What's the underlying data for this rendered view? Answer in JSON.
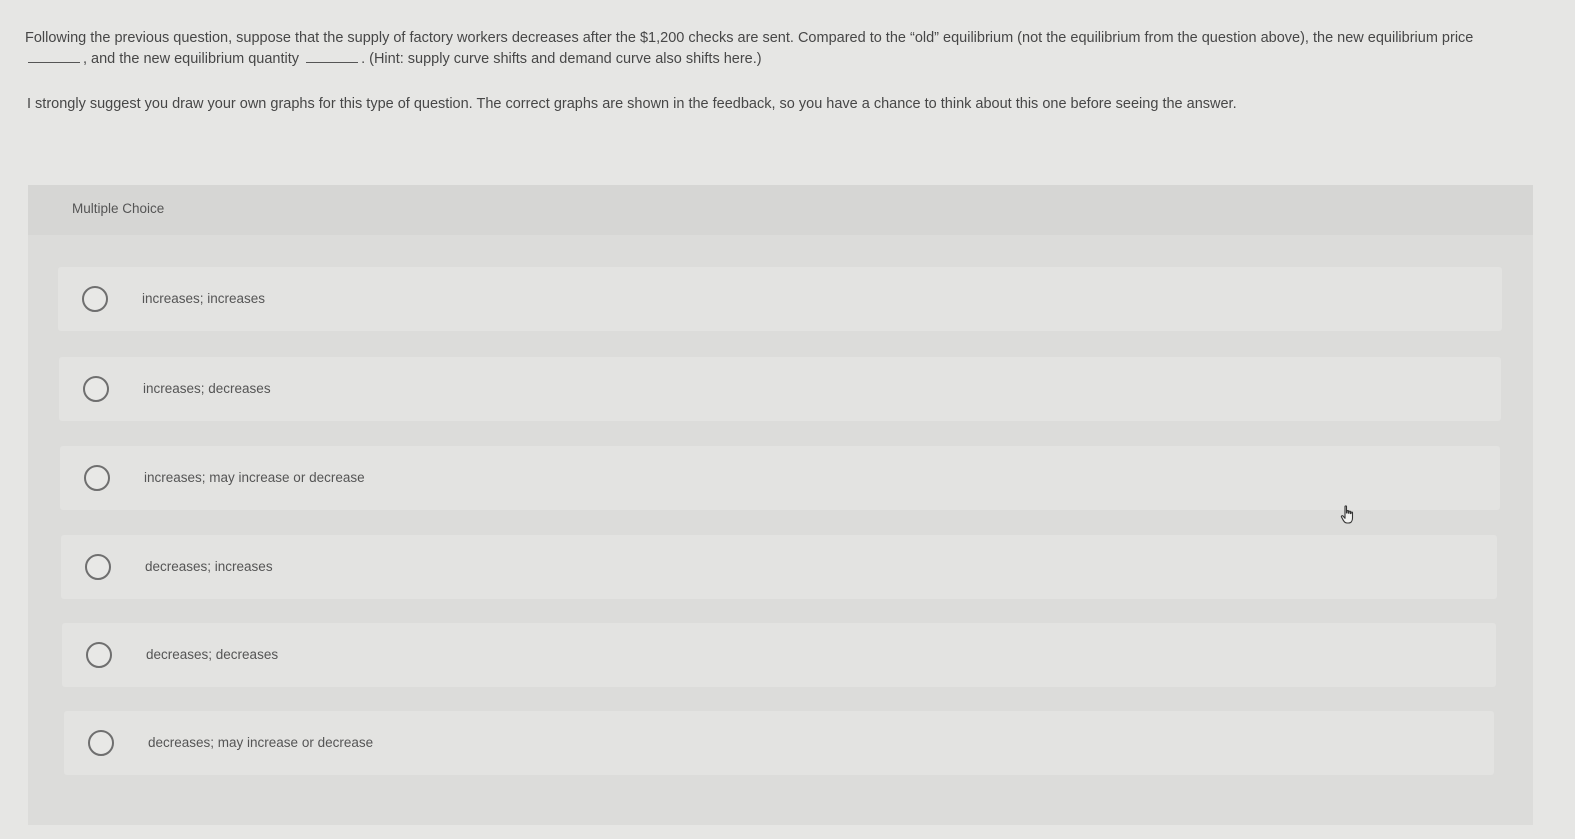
{
  "question": {
    "part1": "Following the previous question, suppose that the supply of factory workers decreases after the $1,200 checks are sent. Compared to the “old” equilibrium (not the equilibrium from the question above), the new equilibrium price",
    "part2": ", and the new equilibrium quantity",
    "part3": ". (Hint: supply curve shifts and demand curve also shifts here.)"
  },
  "suggestion": "I strongly suggest you draw your own graphs for this type of question. The correct graphs are shown in the feedback, so you have a chance to think about this one before seeing the answer.",
  "multiple_choice": {
    "label": "Multiple Choice",
    "options": [
      {
        "label": "increases; increases"
      },
      {
        "label": "increases; decreases"
      },
      {
        "label": "increases; may increase or decrease"
      },
      {
        "label": "decreases; increases"
      },
      {
        "label": "decreases; decreases"
      },
      {
        "label": "decreases; may increase or decrease"
      }
    ]
  },
  "colors": {
    "page_bg": "#e6e6e4",
    "panel_bg": "#dcdcda",
    "option_bg": "#e3e3e1",
    "text": "#474747"
  },
  "icons": {
    "cursor": "hand-pointer-icon"
  }
}
